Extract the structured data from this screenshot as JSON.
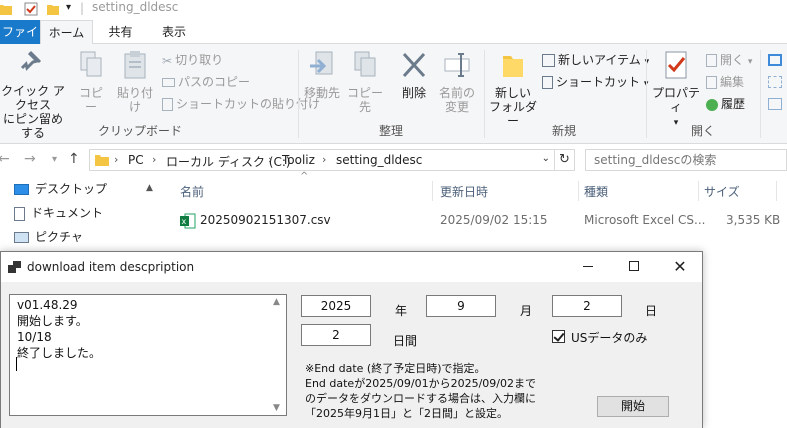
{
  "window": {
    "title": "setting_dldesc"
  },
  "ribbon": {
    "tabs": [
      "ファイル",
      "ホーム",
      "共有",
      "表示"
    ],
    "clipboard": {
      "quick_access_line1": "クイック アクセス",
      "quick_access_line2": "にピン留めする",
      "copy": "コピー",
      "paste": "貼り付け",
      "cut": "切り取り",
      "copy_path": "パスのコピー",
      "paste_shortcut": "ショートカットの貼り付け",
      "group": "クリップボード"
    },
    "organize": {
      "move_to": "移動先",
      "copy_to": "コピー先",
      "delete": "削除",
      "rename_line1": "名前の",
      "rename_line2": "変更",
      "group": "整理"
    },
    "new": {
      "new_folder_line1": "新しい",
      "new_folder_line2": "フォルダー",
      "new_item": "新しいアイテム",
      "shortcut": "ショートカット",
      "group": "新規"
    },
    "open": {
      "properties": "プロパティ",
      "open": "開く",
      "edit": "編集",
      "history": "履歴",
      "group": "開く"
    }
  },
  "address": {
    "crumbs": [
      "PC",
      "ローカル ディスク (C:)",
      "Tooliz",
      "setting_dldesc"
    ],
    "search_placeholder": "setting_dldescの検索"
  },
  "nav": {
    "items": [
      {
        "label": "デスクトップ",
        "icon": "desktop-icon"
      },
      {
        "label": "ドキュメント",
        "icon": "document-icon"
      },
      {
        "label": "ピクチャ",
        "icon": "picture-icon"
      }
    ]
  },
  "filelist": {
    "columns": [
      "名前",
      "更新日時",
      "種類",
      "サイズ"
    ],
    "rows": [
      {
        "name": "20250902151307.csv",
        "modified": "2025/09/02 15:15",
        "type": "Microsoft Excel CS...",
        "size": "3,535 KB"
      }
    ]
  },
  "dialog": {
    "title": "download item descpription",
    "log_lines": [
      "v01.48.29",
      "開始します。",
      "10/18",
      "終了しました。"
    ],
    "year": "2025",
    "year_label": "年",
    "month": "9",
    "month_label": "月",
    "day": "2",
    "day_label": "日",
    "days": "2",
    "days_label": "日間",
    "us_only_label": "USデータのみ",
    "us_only_checked": true,
    "note_lines": [
      "※End date (終了予定日時)で指定。",
      "End dateが2025/09/01から2025/09/02まで",
      "のデータをダウンロードする場合は、入力欄に",
      "「2025年9月1日」と「2日間」と設定。"
    ],
    "start_button": "開始"
  },
  "colors": {
    "accent": "#1979ca",
    "ribbon_bg": "#f5f6f7",
    "dialog_bg": "#f0f0f0"
  }
}
